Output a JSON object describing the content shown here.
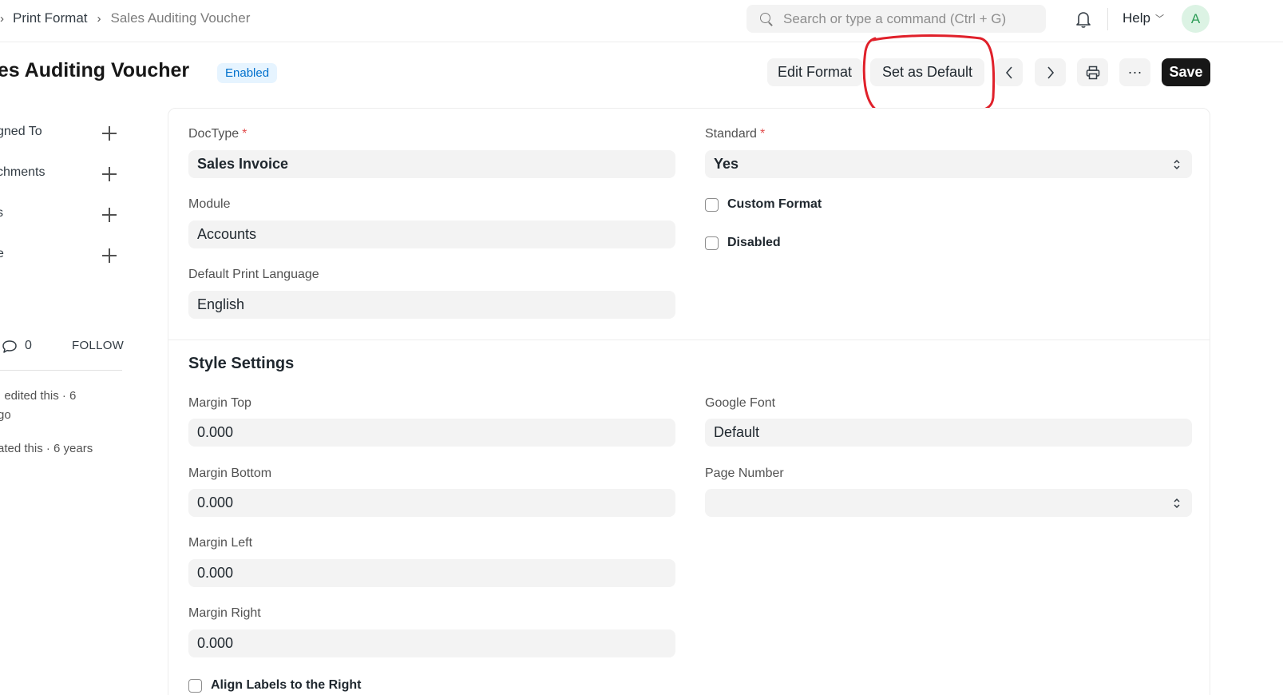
{
  "breadcrumb": {
    "parent": "Print Format",
    "current": "Sales Auditing Voucher"
  },
  "search": {
    "placeholder": "Search or type a command (Ctrl + G)"
  },
  "nav": {
    "help_label": "Help",
    "avatar_initial": "A"
  },
  "page": {
    "title": "ales Auditing Voucher",
    "status": "Enabled"
  },
  "toolbar": {
    "edit_format": "Edit Format",
    "set_as_default": "Set as Default",
    "more": "···",
    "save": "Save"
  },
  "sidebar": {
    "items": [
      {
        "label": "gned To"
      },
      {
        "label": "chments"
      },
      {
        "label": "s"
      },
      {
        "label": "e"
      }
    ],
    "comment_count": "0",
    "follow_label": "FOLLOW",
    "activity": [
      {
        "line1": ": edited this · 6",
        "line2": "go"
      },
      {
        "line1": "ated this · 6 years",
        "line2": ""
      }
    ]
  },
  "form": {
    "doctype_label": "DocType",
    "doctype_value": "Sales Invoice",
    "module_label": "Module",
    "module_value": "Accounts",
    "language_label": "Default Print Language",
    "language_value": "English",
    "standard_label": "Standard",
    "standard_value": "Yes",
    "custom_format_label": "Custom Format",
    "disabled_label": "Disabled",
    "required_mark": "*"
  },
  "style_settings": {
    "title": "Style Settings",
    "margin_top_label": "Margin Top",
    "margin_top_value": "0.000",
    "margin_bottom_label": "Margin Bottom",
    "margin_bottom_value": "0.000",
    "margin_left_label": "Margin Left",
    "margin_left_value": "0.000",
    "margin_right_label": "Margin Right",
    "margin_right_value": "0.000",
    "align_labels_label": "Align Labels to the Right",
    "google_font_label": "Google Font",
    "google_font_value": "Default",
    "page_number_label": "Page Number",
    "page_number_value": ""
  },
  "colors": {
    "accent_badge": "#0070cc",
    "annotation": "#e0202a",
    "primary_button": "#171717"
  },
  "icons": {
    "search": "search-icon",
    "bell": "bell-icon",
    "prev": "chevron-left-icon",
    "next": "chevron-right-icon",
    "print": "printer-icon",
    "comment": "comment-icon",
    "add": "plus-icon"
  }
}
